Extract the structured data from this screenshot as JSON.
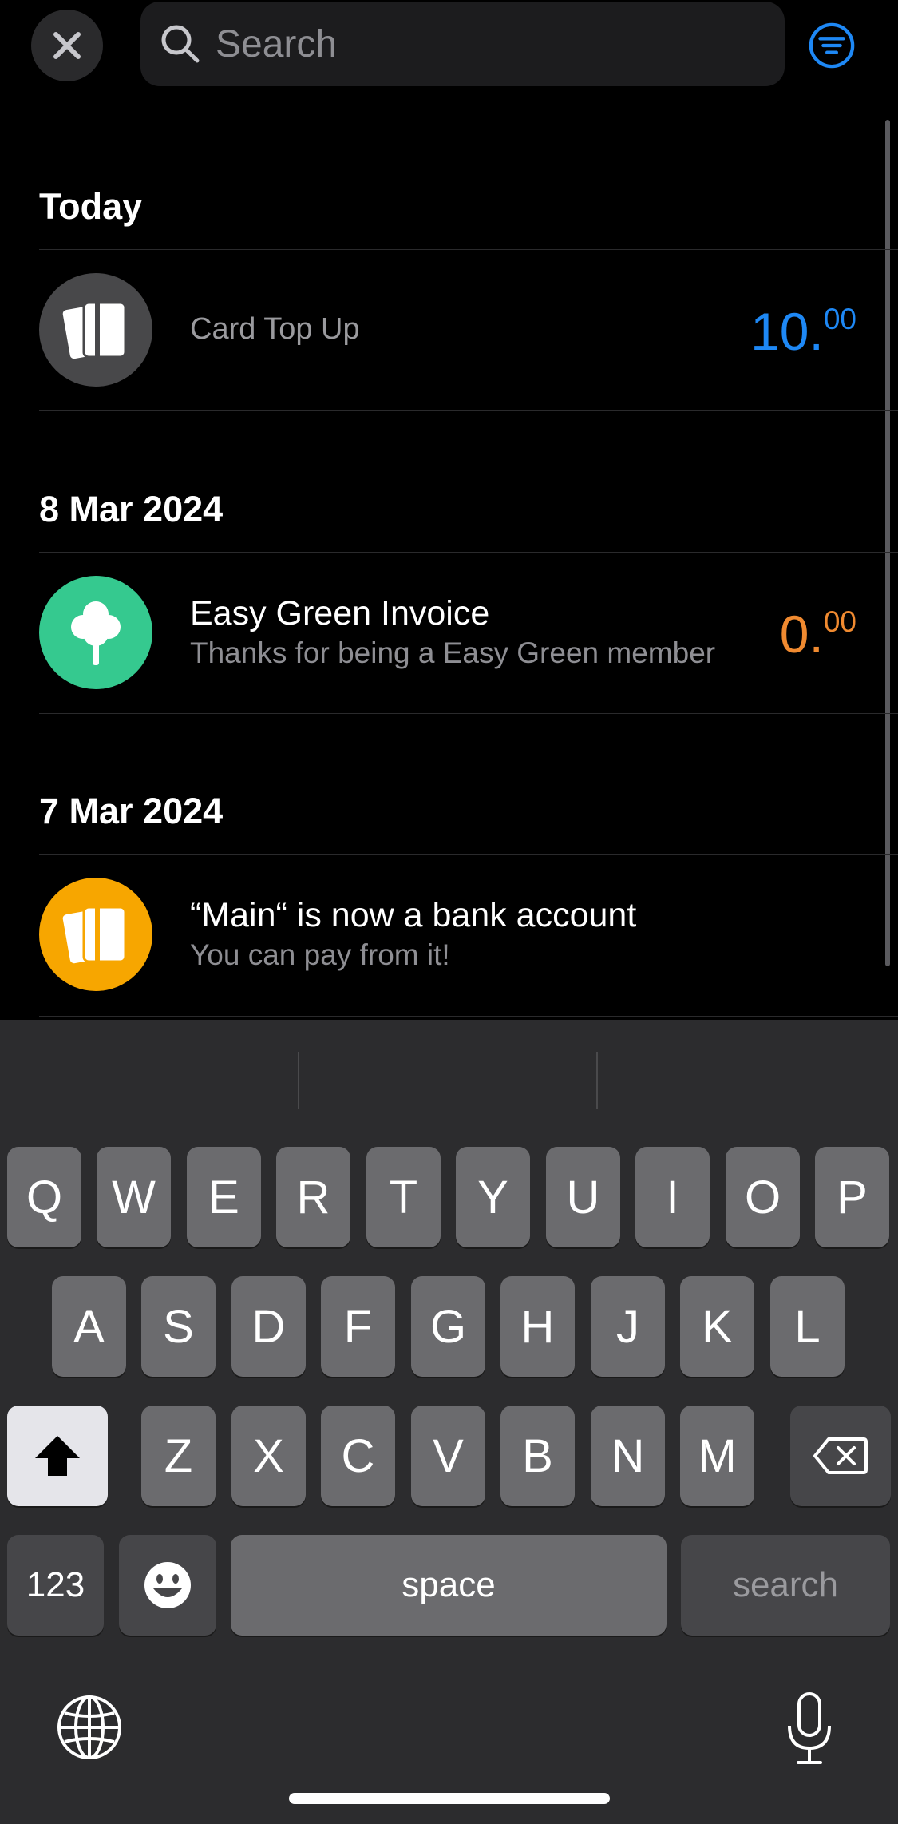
{
  "search": {
    "placeholder": "Search"
  },
  "sections": [
    {
      "header": "Today"
    },
    {
      "header": "8 Mar 2024"
    },
    {
      "header": "7 Mar 2024"
    }
  ],
  "transactions": [
    {
      "title": "Card Top Up",
      "subtitle": "",
      "amount_int": "10.",
      "amount_dec": "00",
      "amount_color": "#1e88f5",
      "avatar_color": "#48484a"
    },
    {
      "title": "Easy Green Invoice",
      "subtitle": "Thanks for being a Easy Green member",
      "amount_int": "0.",
      "amount_dec": "00",
      "amount_color": "#f08a30",
      "avatar_color": "#35c98f"
    },
    {
      "title": "“Main“ is now a bank account",
      "subtitle": "You can pay from it!",
      "amount_int": "",
      "amount_dec": "",
      "amount_color": "#ffffff",
      "avatar_color": "#f7a600"
    }
  ],
  "keyboard": {
    "row1": [
      "Q",
      "W",
      "E",
      "R",
      "T",
      "Y",
      "U",
      "I",
      "O",
      "P"
    ],
    "row2": [
      "A",
      "S",
      "D",
      "F",
      "G",
      "H",
      "J",
      "K",
      "L"
    ],
    "row3": [
      "Z",
      "X",
      "C",
      "V",
      "B",
      "N",
      "M"
    ],
    "numbers": "123",
    "space": "space",
    "search": "search"
  },
  "colors": {
    "accent": "#1e88f5",
    "background": "#000000",
    "keyboard": "#2c2c2e"
  }
}
